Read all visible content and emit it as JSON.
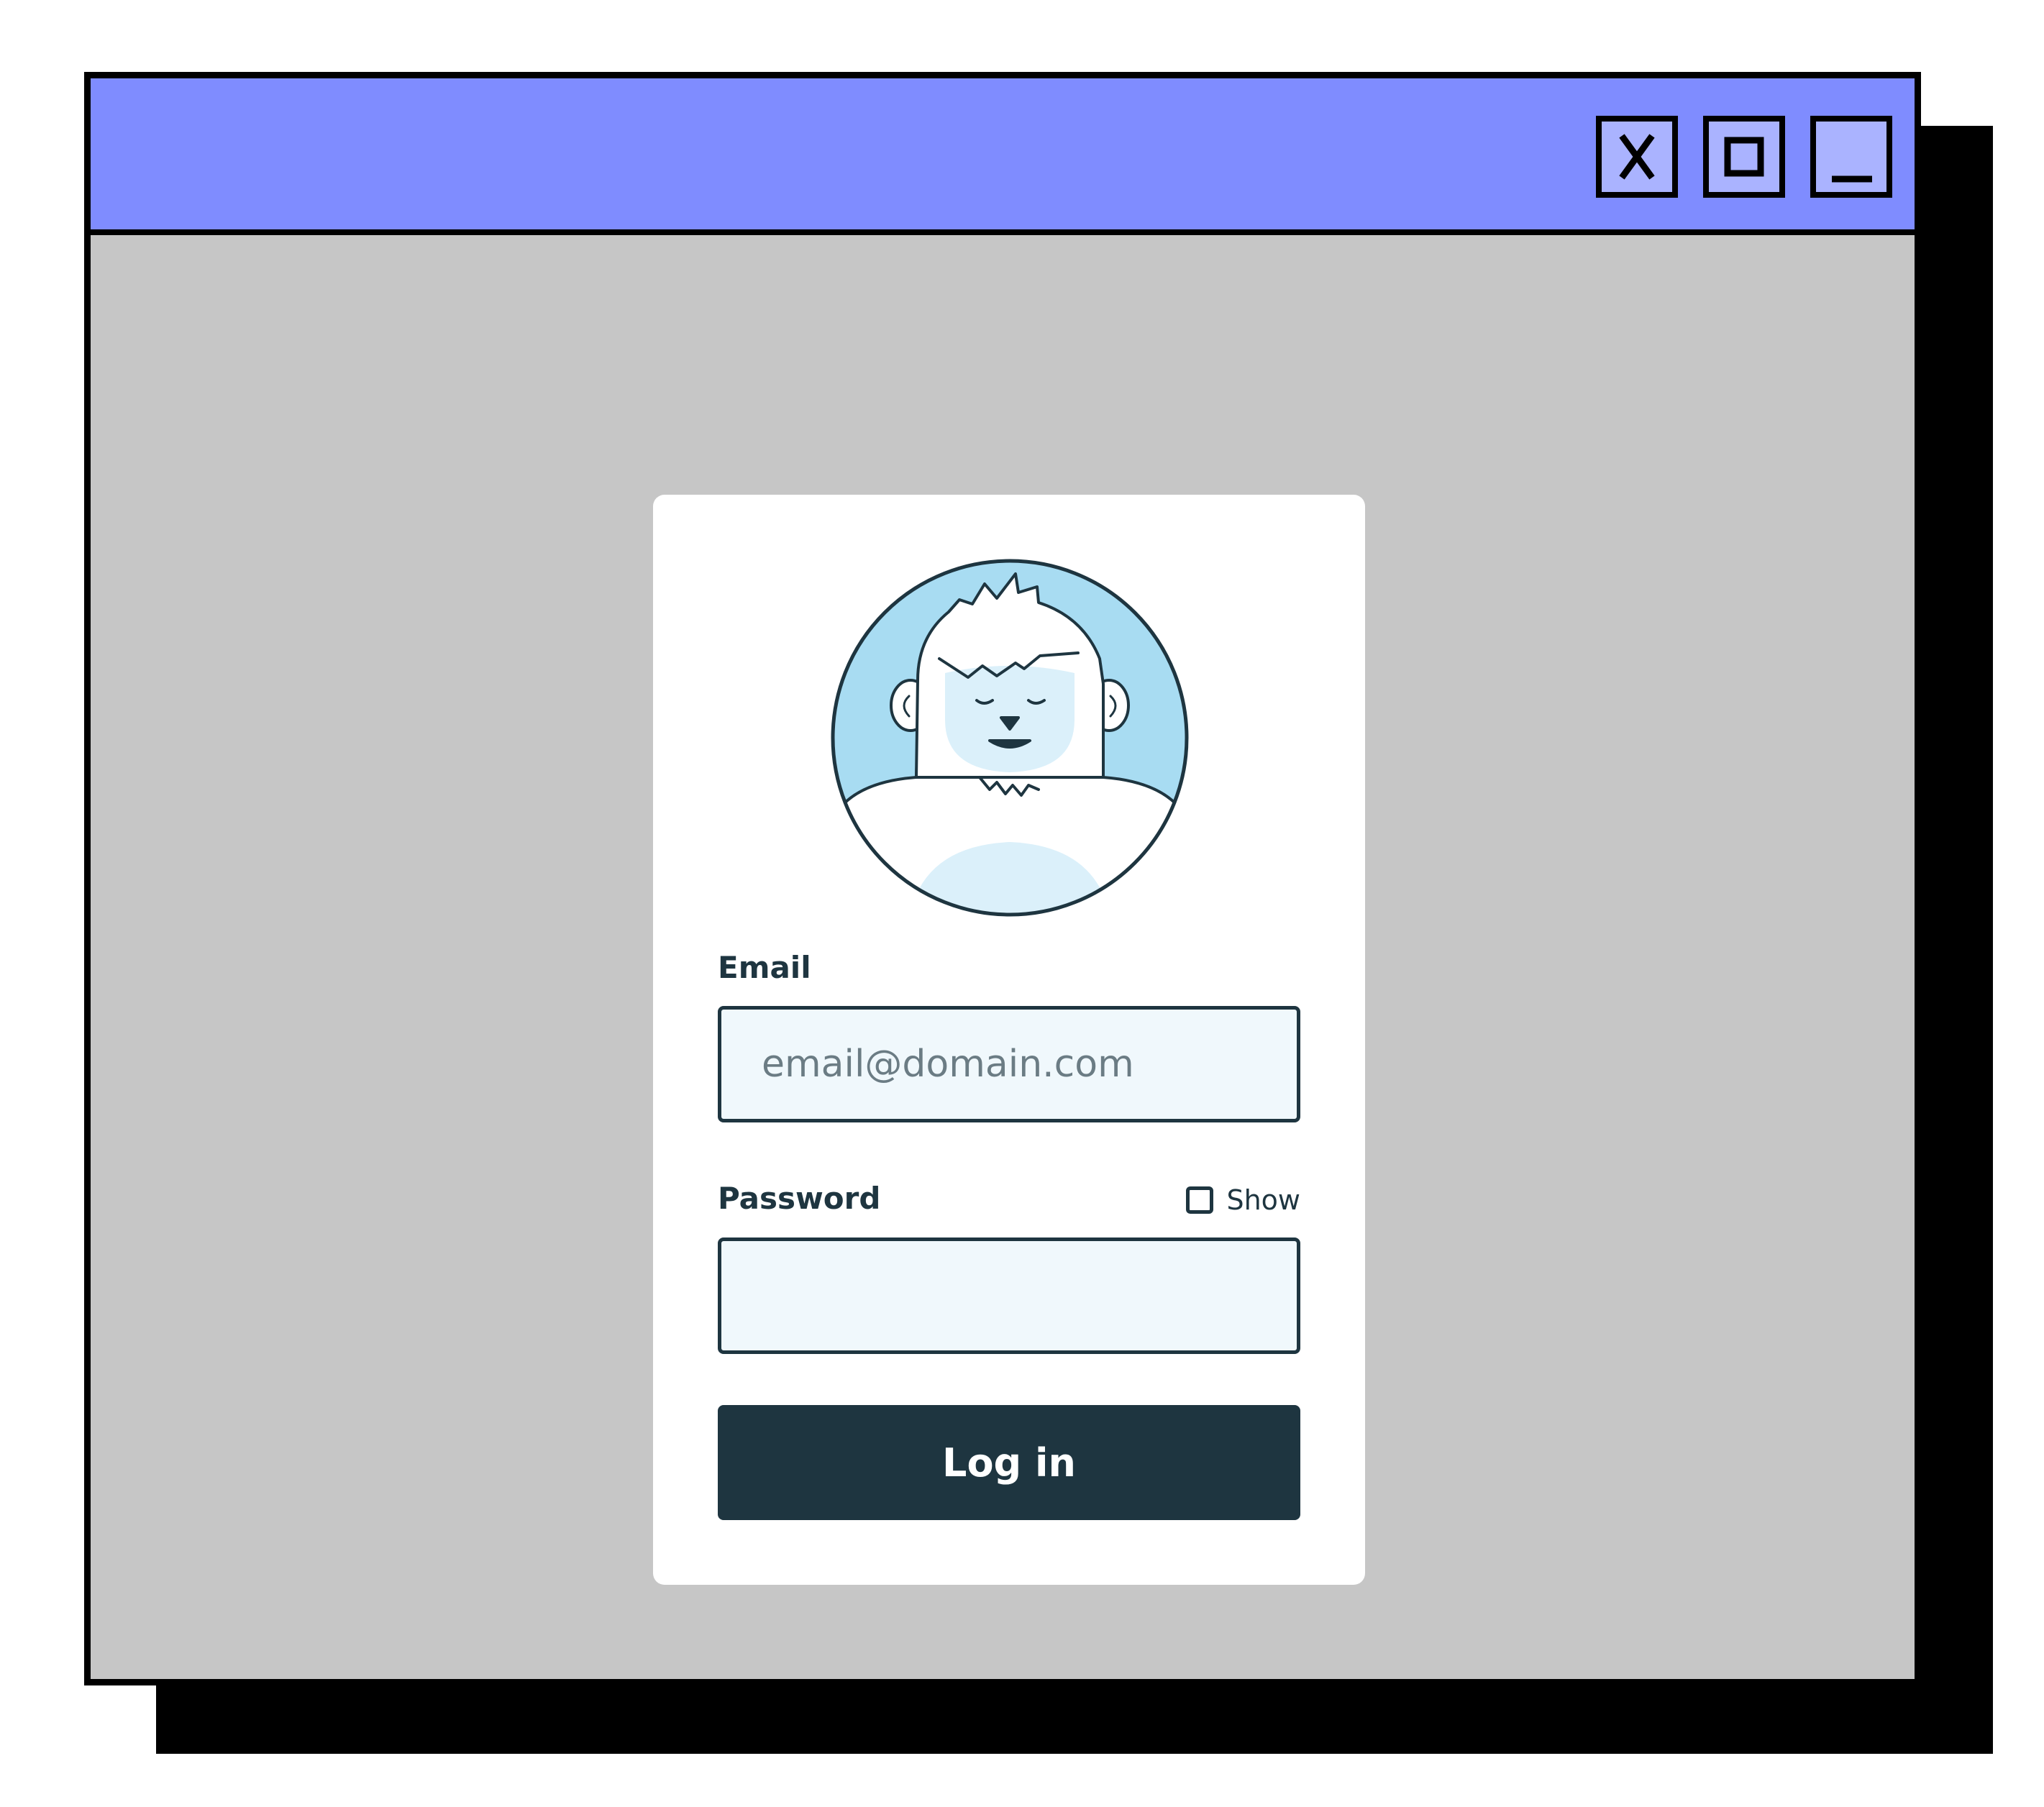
{
  "window": {
    "titlebar_color": "#7f8cff",
    "background_color": "#c6c6c6",
    "controls": [
      {
        "name": "close",
        "icon": "close-x-icon"
      },
      {
        "name": "maximize",
        "icon": "maximize-square-icon"
      },
      {
        "name": "minimize",
        "icon": "minimize-bar-icon"
      }
    ]
  },
  "login_form": {
    "avatar_icon": "yeti-avatar-icon",
    "email": {
      "label": "Email",
      "value": "",
      "placeholder": "email@domain.com"
    },
    "password": {
      "label": "Password",
      "value": "",
      "show_label": "Show",
      "show_checked": false
    },
    "submit_label": "Log in",
    "colors": {
      "primary": "#1e3540",
      "input_background": "#f0f8fc",
      "avatar_background": "#a8dcf2"
    }
  }
}
